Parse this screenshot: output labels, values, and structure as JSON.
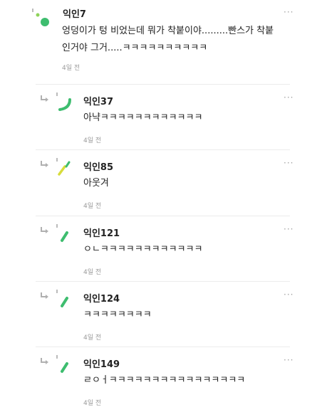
{
  "thread": {
    "comments": [
      {
        "author": "익인7",
        "body_lines": [
          "엉덩이가 텅 비었는데 뭐가 착붙이야.........빤스가 착붙",
          "인거야 그거.....ㅋㅋㅋㅋㅋㅋㅋㅋㅋㅋ"
        ],
        "time": "4일 전",
        "avatar_icon": "green-dots-avatar-icon",
        "more_icon": "more-dots-icon"
      }
    ],
    "replies": [
      {
        "author": "익인37",
        "body": "아냑ㅋㅋㅋㅋㅋㅋㅋㅋㅋㅋㅋㅋ",
        "time": "4일 전",
        "avatar_icon": "green-arc-avatar-icon"
      },
      {
        "author": "익인85",
        "body": "아웃겨",
        "time": "4일 전",
        "avatar_icon": "yellow-green-slash-avatar-icon"
      },
      {
        "author": "익인121",
        "body": "ㅇㄴㅋㅋㅋㅋㅋㅋㅋㅋㅋㅋㅋㅋ",
        "time": "4일 전",
        "avatar_icon": "green-slash-avatar-icon"
      },
      {
        "author": "익인124",
        "body": "ㅋㅋㅋㅋㅋㅋㅋㅋ",
        "time": "4일 전",
        "avatar_icon": "green-slash-avatar-icon"
      },
      {
        "author": "익인149",
        "body": "ㄹㅇㅓㅋㅋㅋㅋㅋㅋㅋㅋㅋㅋㅋㅋㅋㅋㅋㅋ",
        "time": "4일 전",
        "avatar_icon": "green-slash-avatar-icon"
      }
    ],
    "more_label": "···",
    "colors": {
      "accent_green": "#3ebd6f",
      "light_green": "#8fd35a",
      "yellow": "#d8dc3c",
      "muted": "#9a9a9a"
    }
  }
}
